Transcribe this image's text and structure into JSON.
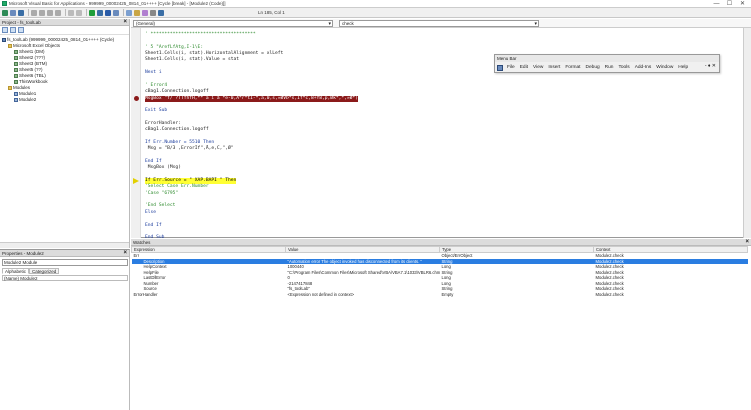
{
  "window": {
    "title": "Microsoft Visual Basic for Applications - 999999_00002425_0814_01++++ [Cycle [break] - [Module2 (Code)]]",
    "controls": [
      "—",
      "☐",
      "✕"
    ]
  },
  "toolbar": {
    "position": "Ln 185, Col 1"
  },
  "project": {
    "title": "Project - fs_toolLab",
    "tree": [
      {
        "label": "fs_toolLab (999999_00002425_0814_01++++ (Cycle)",
        "icon": "proj",
        "level": 0
      },
      {
        "label": "Microsoft Excel Objects",
        "icon": "folder",
        "level": 1
      },
      {
        "label": "Sheet1 (DM)",
        "icon": "sheet",
        "level": 2
      },
      {
        "label": "Sheet2 (???)",
        "icon": "sheet",
        "level": 2
      },
      {
        "label": "Sheet3 (BTM)",
        "icon": "sheet",
        "level": 2
      },
      {
        "label": "Sheet5 (??)",
        "icon": "sheet",
        "level": 2
      },
      {
        "label": "Sheet6 (TBL)",
        "icon": "sheet",
        "level": 2
      },
      {
        "label": "ThisWorkbook",
        "icon": "sheet",
        "level": 2
      },
      {
        "label": "Modules",
        "icon": "folder",
        "level": 1
      },
      {
        "label": "Module1",
        "icon": "mod",
        "level": 2
      },
      {
        "label": "Module2",
        "icon": "mod",
        "level": 2
      }
    ]
  },
  "properties": {
    "title": "Properties - Module2",
    "selector": "Module2 Module",
    "tabs": [
      "Alphabetic",
      "Categorized"
    ],
    "row": "(Name)   Module2"
  },
  "code": {
    "object_combo": "(General)",
    "proc_combo": "check",
    "lines": [
      {
        "text": "' **************************************",
        "kind": "comment"
      },
      {
        "text": "",
        "kind": "plain"
      },
      {
        "text": "' 5 \"ArefLfAtg,I-1\\E:",
        "kind": "comment"
      },
      {
        "text": "Sheet1.Cells(i, stat).HorizontalAlignment = xlLeft",
        "kind": "plain"
      },
      {
        "text": "Sheet1.Cells(i, stat).Value = stat",
        "kind": "plain"
      },
      {
        "text": "",
        "kind": "plain"
      },
      {
        "text": "Next i",
        "kind": "keyword"
      },
      {
        "text": "",
        "kind": "plain"
      },
      {
        "text": "' Error4",
        "kind": "comment"
      },
      {
        "text": "cBag1.Connection.logoff",
        "kind": "plain"
      },
      {
        "text": "MsgBox \"f/ ?TTfhfH,** ä í á *e-0,Ä*r*tI-*,a,0,s,»ØVÞ*s,If*c,8+Ÿ8,p,Øk*,*,»Ø*)",
        "kind": "err"
      },
      {
        "text": "",
        "kind": "plain"
      },
      {
        "text": "Exit Sub",
        "kind": "keyword"
      },
      {
        "text": "",
        "kind": "plain"
      },
      {
        "text": "ErrorHandler:",
        "kind": "plain"
      },
      {
        "text": "cBag1.Connection.logoff",
        "kind": "plain"
      },
      {
        "text": "",
        "kind": "plain"
      },
      {
        "text": "If Err.Number = 5510 Then",
        "kind": "keyword"
      },
      {
        "text": " Msg = \"B/3 ,ErrorIf\",Ä,e,C,\",Ø\"",
        "kind": "plain"
      },
      {
        "text": "",
        "kind": "plain"
      },
      {
        "text": "End If",
        "kind": "keyword"
      },
      {
        "text": " MsgBox (Msg)",
        "kind": "plain"
      },
      {
        "text": "",
        "kind": "plain"
      },
      {
        "text": "If Err.Source = \" XAP.BAPI \" Then",
        "kind": "hl"
      },
      {
        "text": "'Select Case Err.Number",
        "kind": "comment"
      },
      {
        "text": "'Case \"6795\"",
        "kind": "comment"
      },
      {
        "text": "",
        "kind": "plain"
      },
      {
        "text": "'End Select",
        "kind": "comment"
      },
      {
        "text": "Else",
        "kind": "keyword"
      },
      {
        "text": "",
        "kind": "plain"
      },
      {
        "text": "End If",
        "kind": "keyword"
      },
      {
        "text": "",
        "kind": "plain"
      },
      {
        "text": "End Sub",
        "kind": "keyword"
      }
    ]
  },
  "menubar": {
    "title": "Menu Bar",
    "items": [
      "File",
      "Edit",
      "View",
      "Insert",
      "Format",
      "Debug",
      "Run",
      "Tools",
      "Add-Ins",
      "Window",
      "Help"
    ],
    "right": "- ♦ ✕"
  },
  "watches": {
    "title": "Watches",
    "columns": [
      "Expression",
      "Value",
      "Type",
      "Context"
    ],
    "rows": [
      {
        "expr": "Err",
        "value": "",
        "type": "Object/ErrObject",
        "context": "Module2.check",
        "indent": 0,
        "sel": false
      },
      {
        "expr": "Description",
        "value": "\"Automation error The object invoked has disconnected from its clients. \"",
        "type": "String",
        "context": "Module2.check",
        "indent": 1,
        "sel": true
      },
      {
        "expr": "HelpContext",
        "value": "1000440",
        "type": "Long",
        "context": "Module2.check",
        "indent": 1,
        "sel": false
      },
      {
        "expr": "HelpFile",
        "value": "\"C:\\Program Files\\Common Files\\Microsoft Shared\\VBA\\VBA7.1\\1033\\VBLR6.chm\"",
        "type": "String",
        "context": "Module2.check",
        "indent": 1,
        "sel": false
      },
      {
        "expr": "LastDllError",
        "value": "0",
        "type": "Long",
        "context": "Module2.check",
        "indent": 1,
        "sel": false
      },
      {
        "expr": "Number",
        "value": "-2147417848",
        "type": "Long",
        "context": "Module2.check",
        "indent": 1,
        "sel": false
      },
      {
        "expr": "Source",
        "value": "\"fs_toolLab\"",
        "type": "String",
        "context": "Module2.check",
        "indent": 1,
        "sel": false
      },
      {
        "expr": "ErrorHandler",
        "value": "<Expression not defined in context>",
        "type": "Empty",
        "context": "Module2.check",
        "indent": 0,
        "sel": false
      }
    ]
  }
}
